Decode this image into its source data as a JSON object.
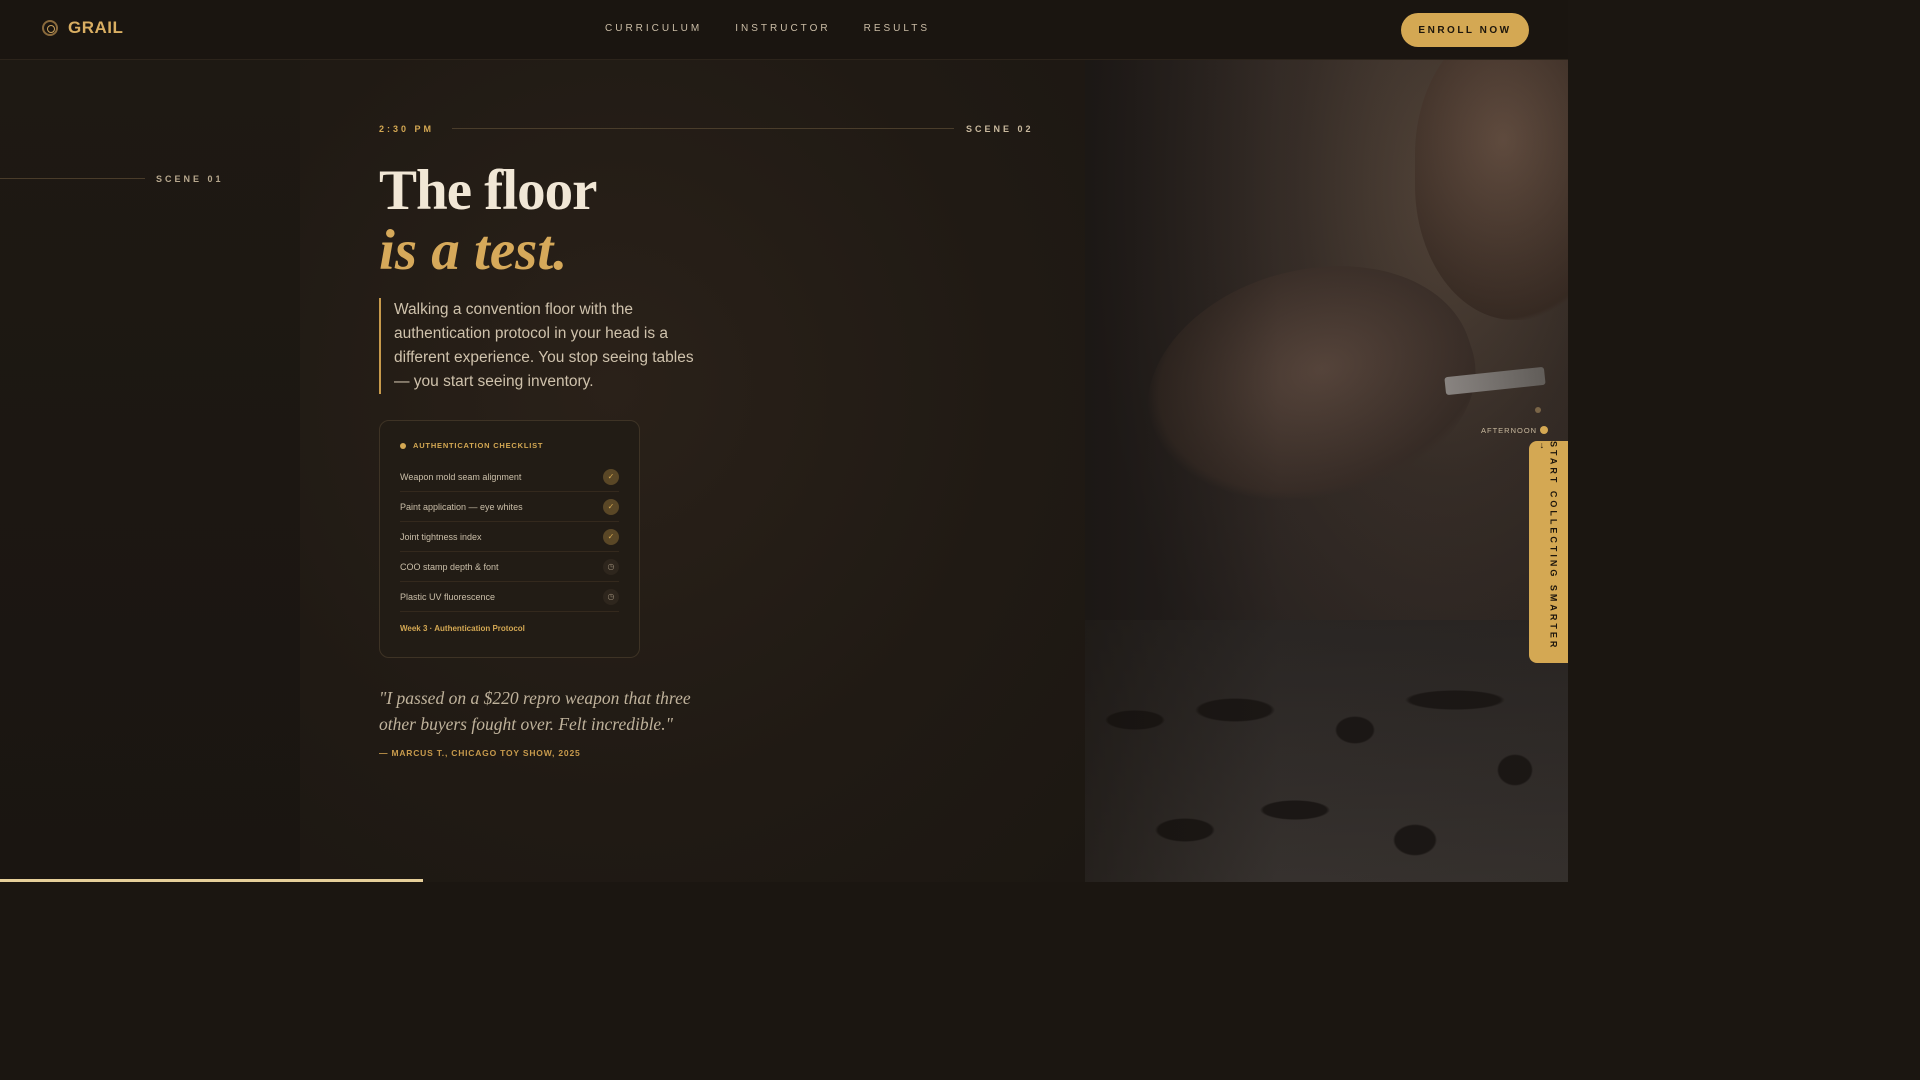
{
  "nav": {
    "brand": "GRAIL",
    "links": [
      "CURRICULUM",
      "INSTRUCTOR",
      "RESULTS"
    ],
    "cta": "ENROLL NOW"
  },
  "scene_left": {
    "label": "SCENE 01"
  },
  "scene": {
    "time": "2:30 PM",
    "label": "SCENE 02",
    "title_line1": "The floor",
    "title_line2": "is a test.",
    "lead": "Walking a convention floor with the authentication protocol in your head is a different experience. You stop seeing tables — you start seeing inventory."
  },
  "checklist": {
    "title": "AUTHENTICATION CHECKLIST",
    "items": [
      {
        "label": "Weapon mold seam alignment",
        "status": "done",
        "icon": "✓"
      },
      {
        "label": "Paint application — eye whites",
        "status": "done",
        "icon": "✓"
      },
      {
        "label": "Joint tightness index",
        "status": "done",
        "icon": "✓"
      },
      {
        "label": "COO stamp depth & font",
        "status": "pending",
        "icon": "◷"
      },
      {
        "label": "Plastic UV fluorescence",
        "status": "pending",
        "icon": "◷"
      }
    ],
    "footer": "Week 3 · Authentication Protocol"
  },
  "testimonial": {
    "quote": "\"I passed on a $220 repro weapon that three other buyers fought over. Felt incredible.\"",
    "attribution": "— MARCUS T., CHICAGO TOY SHOW, 2025"
  },
  "timeline": {
    "current": "AFTERNOON"
  },
  "side_cta": "START COLLECTING SMARTER →",
  "colors": {
    "accent": "#d4a853",
    "background": "#1b1611",
    "text": "#e8dcc8"
  },
  "progress": {
    "fraction": 0.27
  }
}
